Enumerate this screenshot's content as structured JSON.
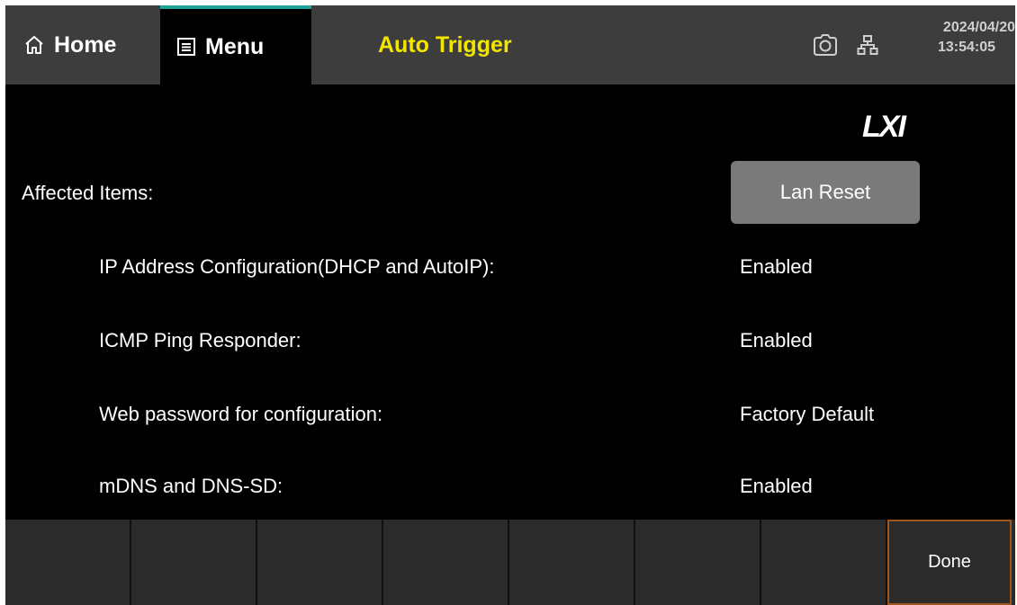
{
  "header": {
    "home_label": "Home",
    "menu_label": "Menu",
    "title": "Auto Trigger",
    "date": "2024/04/20",
    "time": "13:54:05"
  },
  "logo_text": "LXI",
  "affected_label": "Affected Items:",
  "lan_reset_label": "Lan Reset",
  "items": [
    {
      "label": "IP Address Configuration(DHCP and AutoIP):",
      "value": "Enabled"
    },
    {
      "label": "ICMP Ping Responder:",
      "value": "Enabled"
    },
    {
      "label": "Web password for configuration:",
      "value": "Factory Default"
    },
    {
      "label": "mDNS and DNS-SD:",
      "value": "Enabled"
    }
  ],
  "softkeys": {
    "done_label": "Done"
  },
  "colors": {
    "title_yellow": "#f2e600",
    "tab_accent": "#1ea39a",
    "done_border": "#a0561a",
    "button_gray": "#7a7a7a"
  }
}
